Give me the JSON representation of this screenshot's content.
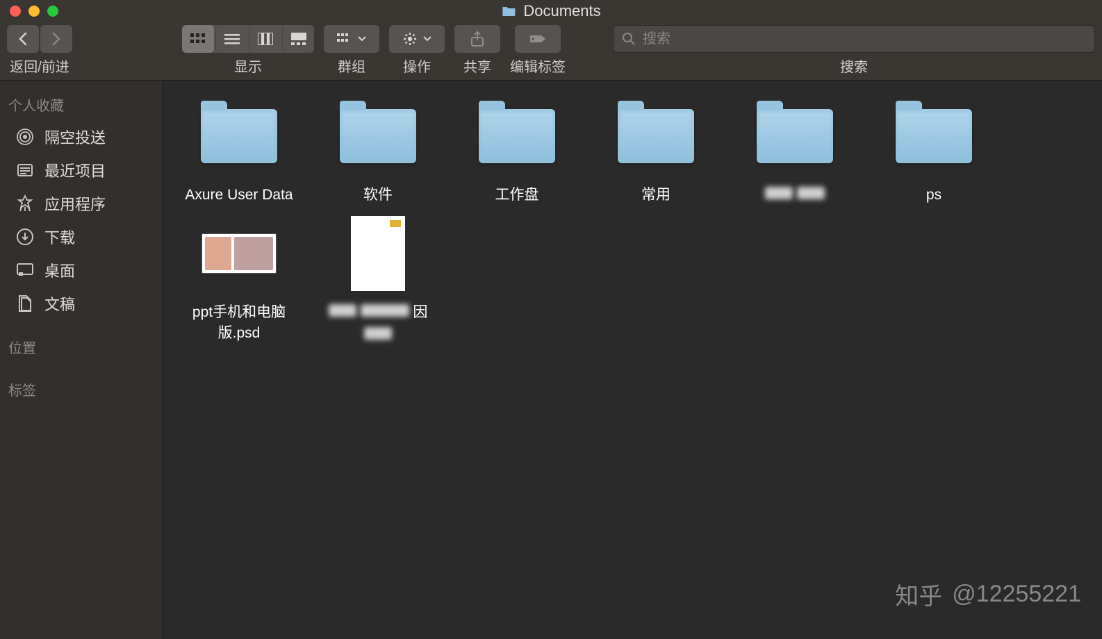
{
  "window": {
    "title": "Documents"
  },
  "toolbar": {
    "nav_label": "返回/前进",
    "view_label": "显示",
    "group_label": "群组",
    "action_label": "操作",
    "share_label": "共享",
    "tags_label": "编辑标签",
    "search_label": "搜索",
    "search_placeholder": "搜索"
  },
  "sidebar": {
    "section_favorites": "个人收藏",
    "section_locations": "位置",
    "section_tags": "标签",
    "items": [
      {
        "label": "隔空投送",
        "icon": "airdrop"
      },
      {
        "label": "最近项目",
        "icon": "recents"
      },
      {
        "label": "应用程序",
        "icon": "apps"
      },
      {
        "label": "下载",
        "icon": "downloads"
      },
      {
        "label": "桌面",
        "icon": "desktop"
      },
      {
        "label": "文稿",
        "icon": "documents"
      }
    ]
  },
  "content": {
    "items": [
      {
        "label": "Axure User Data",
        "type": "folder"
      },
      {
        "label": "软件",
        "type": "folder"
      },
      {
        "label": "工作盘",
        "type": "folder"
      },
      {
        "label": "常用",
        "type": "folder"
      },
      {
        "label": "██",
        "type": "folder",
        "blurred": true
      },
      {
        "label": "ps",
        "type": "folder"
      },
      {
        "label": "ppt手机和电脑版.psd",
        "type": "file-psd"
      },
      {
        "label": "██████ 因 █",
        "type": "file-doc",
        "blurred": true
      }
    ]
  },
  "watermark": {
    "brand": "知乎",
    "user": "@12255221"
  }
}
